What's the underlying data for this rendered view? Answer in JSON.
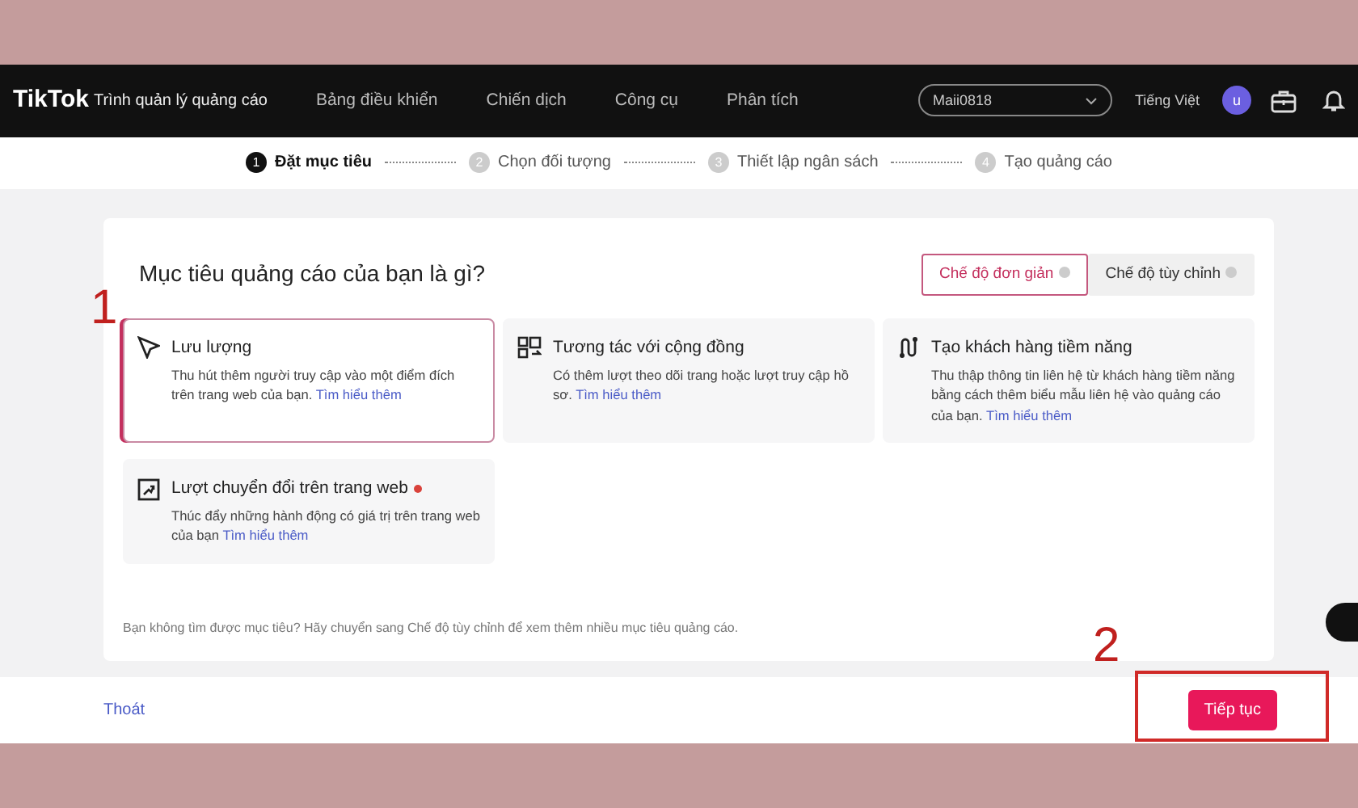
{
  "header": {
    "logo": "TikTok",
    "product": "Trình quản lý quảng cáo",
    "nav": [
      "Bảng điều khiển",
      "Chiến dịch",
      "Công cụ",
      "Phân tích"
    ],
    "account": "Maii0818",
    "language": "Tiếng Việt",
    "avatar": "u"
  },
  "steps": [
    {
      "number": "1",
      "label": "Đặt mục tiêu",
      "selected": true
    },
    {
      "number": "2",
      "label": "Chọn đối tượng",
      "selected": false
    },
    {
      "number": "3",
      "label": "Thiết lập ngân sách",
      "selected": false
    },
    {
      "number": "4",
      "label": "Tạo quảng cáo",
      "selected": false
    }
  ],
  "title": "Mục tiêu quảng cáo của bạn là gì?",
  "modes": [
    {
      "label": "Chế độ đơn giản",
      "selected": true
    },
    {
      "label": "Chế độ tùy chỉnh",
      "selected": false
    }
  ],
  "objectives": [
    {
      "title": "Lưu lượng",
      "description": "Thu hút thêm người truy cập vào một điểm đích trên trang web của bạn.",
      "link": "Tìm hiểu thêm",
      "selected": true,
      "marked": false
    },
    {
      "title": "Tương tác với cộng đồng",
      "description": "Có thêm lượt theo dõi trang hoặc lượt truy cập hồ sơ.",
      "link": "Tìm hiểu thêm",
      "selected": false,
      "marked": false
    },
    {
      "title": "Tạo khách hàng tiềm năng",
      "description": "Thu thập thông tin liên hệ từ khách hàng tiềm năng bằng cách thêm biểu mẫu liên hệ vào quảng cáo của bạn.",
      "link": "Tìm hiểu thêm",
      "selected": false,
      "marked": false
    },
    {
      "title": "Lượt chuyển đổi trên trang web",
      "description": "Thúc đẩy những hành động có giá trị trên trang web của bạn",
      "link": "Tìm hiểu thêm",
      "selected": false,
      "marked": true
    }
  ],
  "hint": "Bạn không tìm được mục tiêu? Hãy chuyển sang Chế độ tùy chỉnh để xem thêm nhiều mục tiêu quảng cáo.",
  "footer": {
    "exit": "Thoát",
    "next": "Tiếp tục"
  },
  "annotations": [
    {
      "label": "1"
    },
    {
      "label": "2"
    }
  ]
}
